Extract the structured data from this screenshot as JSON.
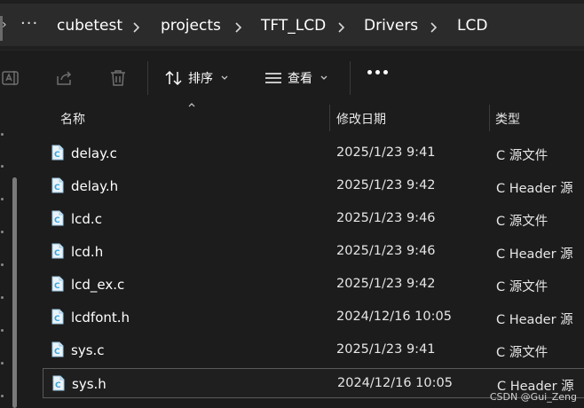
{
  "breadcrumb": {
    "more": "···",
    "items": [
      "cubetest",
      "projects",
      "TFT_LCD",
      "Drivers",
      "LCD"
    ]
  },
  "toolbar": {
    "sort_label": "排序",
    "view_label": "查看",
    "icons": [
      "rename-icon",
      "share-icon",
      "delete-icon",
      "sort-icon",
      "view-icon",
      "more-icon"
    ]
  },
  "columns": {
    "name": "名称",
    "modified": "修改日期",
    "type": "类型"
  },
  "files": [
    {
      "name": "delay.c",
      "modified": "2025/1/23 9:41",
      "type": "C 源文件"
    },
    {
      "name": "delay.h",
      "modified": "2025/1/23 9:42",
      "type": "C Header 源"
    },
    {
      "name": "lcd.c",
      "modified": "2025/1/23 9:46",
      "type": "C 源文件"
    },
    {
      "name": "lcd.h",
      "modified": "2025/1/23 9:46",
      "type": "C Header 源"
    },
    {
      "name": "lcd_ex.c",
      "modified": "2025/1/23 9:42",
      "type": "C 源文件"
    },
    {
      "name": "lcdfont.h",
      "modified": "2024/12/16 10:05",
      "type": "C Header 源"
    },
    {
      "name": "sys.c",
      "modified": "2025/1/23 9:41",
      "type": "C 源文件"
    },
    {
      "name": "sys.h",
      "modified": "2024/12/16 10:05",
      "type": "C Header 源"
    }
  ],
  "watermark": "CSDN @Gui_Zeng",
  "colors": {
    "background": "#1c1c1c",
    "address_bar": "#2b2b2b",
    "file_icon": "#3ba3d8"
  }
}
